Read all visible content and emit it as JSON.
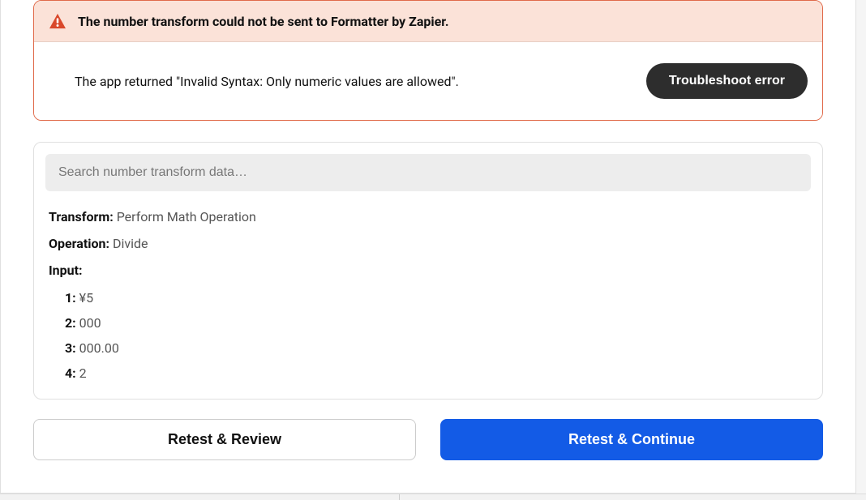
{
  "error": {
    "title": "The number transform could not be sent to Formatter by Zapier.",
    "message": "The app returned \"Invalid Syntax: Only numeric values are allowed\".",
    "troubleshoot_button": "Troubleshoot error"
  },
  "panel": {
    "search_placeholder": "Search number transform data…",
    "transform_label": "Transform:",
    "transform_value": "Perform Math Operation",
    "operation_label": "Operation:",
    "operation_value": "Divide",
    "input_label": "Input:",
    "inputs": [
      {
        "key": "1:",
        "value": "¥5"
      },
      {
        "key": "2:",
        "value": "000"
      },
      {
        "key": "3:",
        "value": "000.00"
      },
      {
        "key": "4:",
        "value": "2"
      }
    ]
  },
  "buttons": {
    "retest_review": "Retest & Review",
    "retest_continue": "Retest & Continue"
  },
  "colors": {
    "error_border": "#e06a4a",
    "error_bg": "#fbe2d8",
    "primary": "#135be6",
    "dark": "#2d2d2d"
  }
}
